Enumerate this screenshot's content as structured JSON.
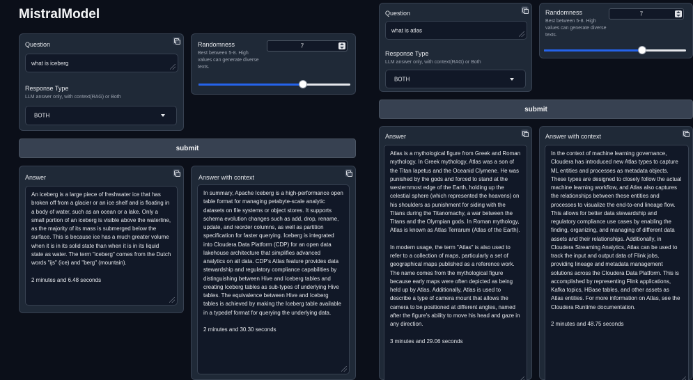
{
  "app_title": "MistralModel",
  "labels": {
    "question": "Question",
    "response_type": "Response Type",
    "response_type_info": "LLM answer only, with context(RAG) or Both",
    "randomness": "Randomness",
    "randomness_info": "Best between 5-8. High values can generate diverse texts.",
    "submit": "submit",
    "answer": "Answer",
    "answer_with_context": "Answer with context"
  },
  "left": {
    "question_value": "what is iceberg",
    "response_type_value": "BOTH",
    "randomness_value": "7",
    "slider_fraction": 0.69,
    "answer": "An iceberg is a large piece of freshwater ice that has broken off from a glacier or an ice shelf and is floating in a body of water, such as an ocean or a lake. Only a small portion of an iceberg is visible above the waterline, as the majority of its mass is submerged below the surface. This is because ice has a much greater volume when it is in its solid state than when it is in its liquid state as water. The term \"iceberg\" comes from the Dutch words \"ijs\" (ice) and \"berg\" (mountain).\n\n2 minutes and 6.48 seconds",
    "answer_with_context": "In summary, Apache Iceberg is a high-performance open table format for managing petabyte-scale analytic datasets on file systems or object stores. It supports schema evolution changes such as add, drop, rename, update, and reorder columns, as well as partition specification for faster querying. Iceberg is integrated into Cloudera Data Platform (CDP) for an open data lakehouse architecture that simplifies advanced analytics on all data. CDP's Atlas feature provides data stewardship and regulatory compliance capabilities by distinguishing between Hive and Iceberg tables and creating Iceberg tables as sub-types of underlying Hive tables. The equivalence between Hive and Iceberg tables is achieved by making the Iceberg table available in a typedef format for querying the underlying data.\n\n2 minutes and 30.30 seconds"
  },
  "right": {
    "question_value": "what is atlas",
    "response_type_value": "BOTH",
    "randomness_value": "7",
    "slider_fraction": 0.69,
    "answer": "Atlas is a mythological figure from Greek and Roman mythology. In Greek mythology, Atlas was a son of the Titan Iapetus and the Oceanid Clymene. He was punished by the gods and forced to stand at the westernmost edge of the Earth, holding up the celestial sphere (which represented the heavens) on his shoulders as punishment for siding with the Titans during the Titanomachy, a war between the Titans and the Olympian gods. In Roman mythology, Atlas is known as Atlas Terrarum (Atlas of the Earth).\n\nIn modern usage, the term \"Atlas\" is also used to refer to a collection of maps, particularly a set of geographical maps published as a reference work. The name comes from the mythological figure because early maps were often depicted as being held up by Atlas. Additionally, Atlas is used to describe a type of camera mount that allows the camera to be positioned at different angles, named after the figure's ability to move his head and gaze in any direction.\n\n3 minutes and 29.06 seconds",
    "answer_with_context": "In the context of machine learning governance, Cloudera has introduced new Atlas types to capture ML entities and processes as metadata objects. These types are designed to closely follow the actual machine learning workflow, and Atlas also captures the relationships between these entities and processes to visualize the end-to-end lineage flow. This allows for better data stewardship and regulatory compliance use cases by enabling the finding, organizing, and managing of different data assets and their relationships. Additionally, in Cloudera Streaming Analytics, Atlas can be used to track the input and output data of Flink jobs, providing lineage and metadata management solutions across the Cloudera Data Platform. This is accomplished by representing Flink applications, Kafka topics, HBase tables, and other assets as Atlas entities. For more information on Atlas, see the Cloudera Runtime documentation.\n\n2 minutes and 48.75 seconds"
  },
  "icons": {
    "copy": "copy-icon",
    "caret": "chevron-down-icon",
    "resize": "resize-handle-icon",
    "spinner": "number-spinner-icon"
  },
  "colors": {
    "background": "#0b0f19",
    "panel": "#1f2937",
    "slider_fill": "#2563eb"
  }
}
